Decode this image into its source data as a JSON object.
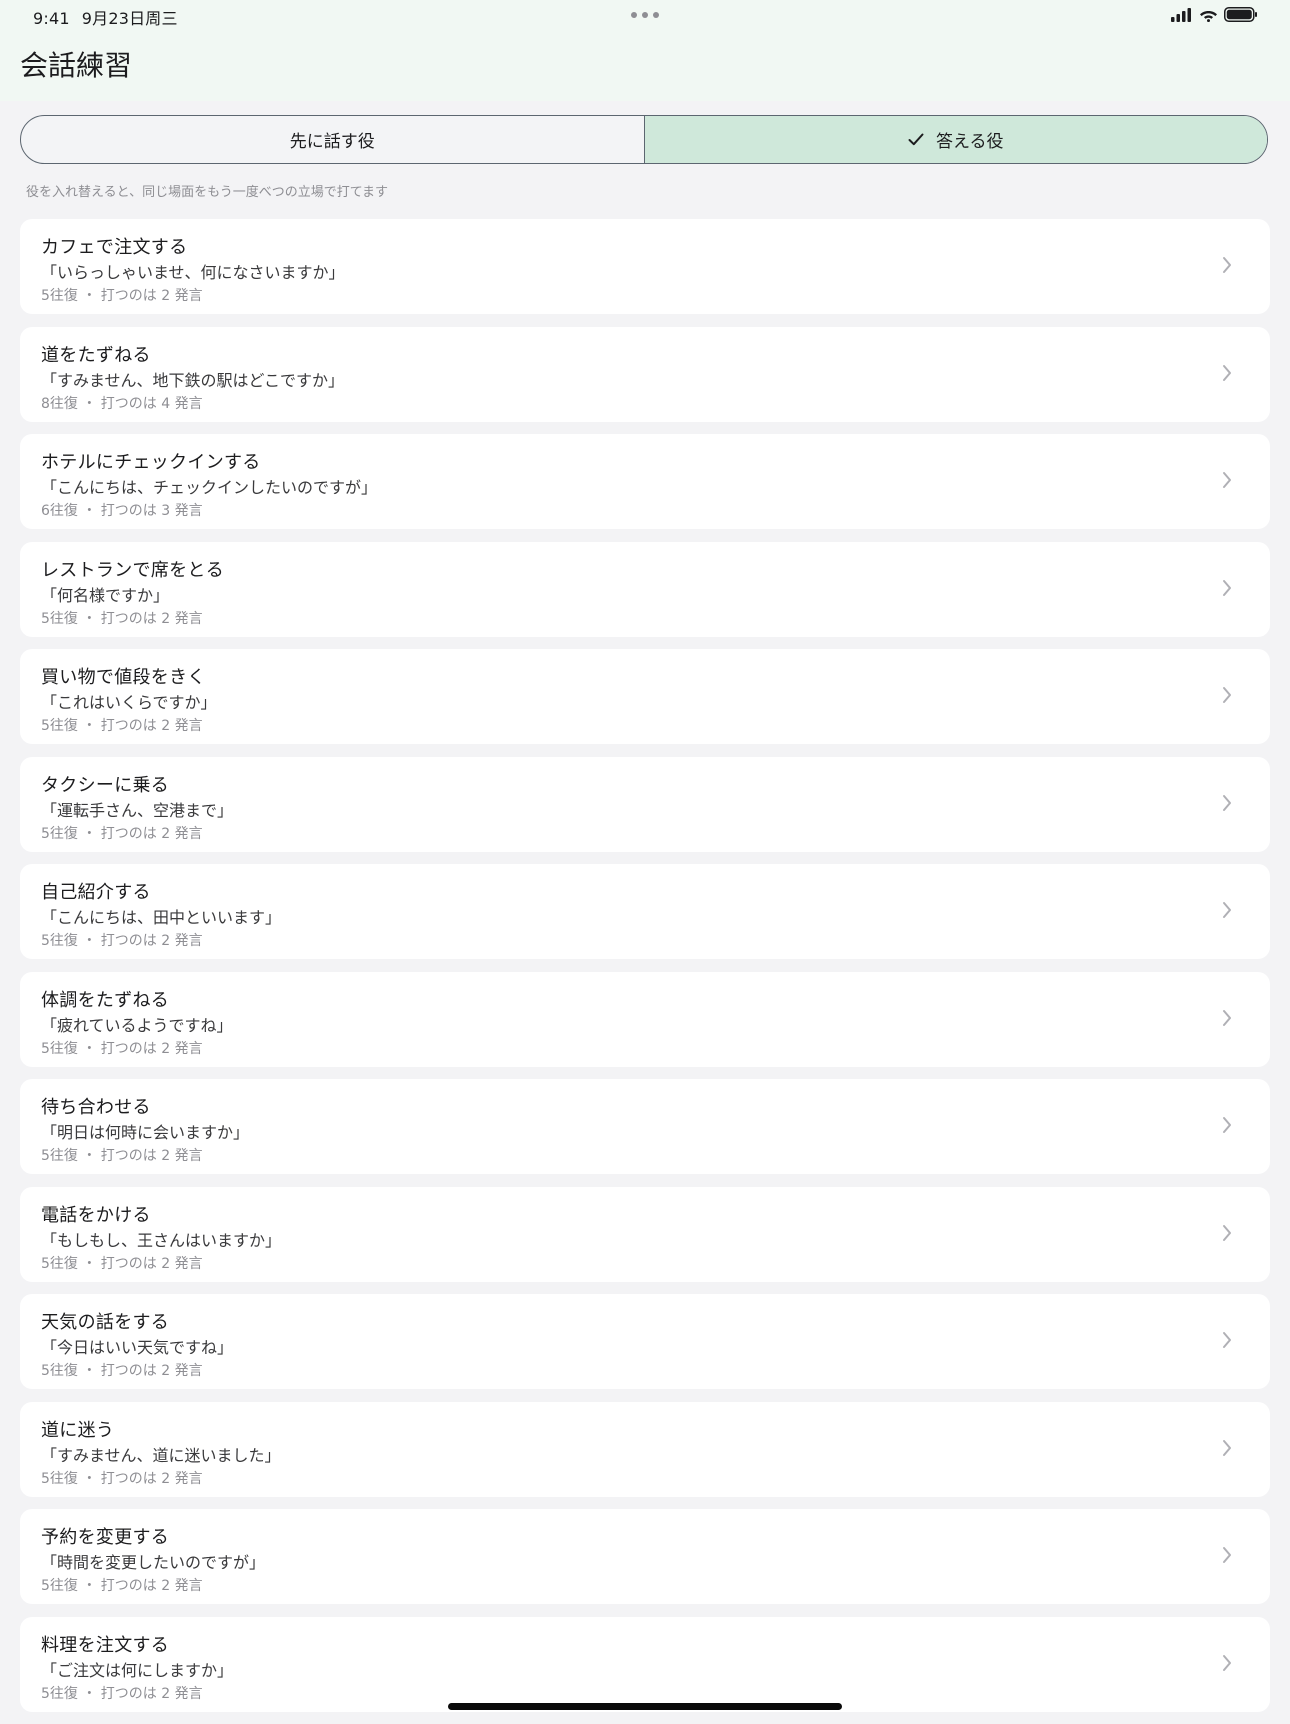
{
  "status": {
    "time": "9:41",
    "date": "9月23日周三"
  },
  "header": {
    "title": "会話練習"
  },
  "role_toggle": {
    "options": [
      "先に話す役",
      "答える役"
    ],
    "selected": "答える役"
  },
  "hint": "役を入れ替えると、同じ場面をもう一度べつの立場で打てます",
  "colors": {
    "header_bg": "#f1f8f3",
    "selected_segment": "#cfe8da",
    "page_bg": "#f3f3f5"
  },
  "scenarios": [
    {
      "title": "カフェで注文する",
      "quote": "「いらっしゃいませ、何になさいますか」",
      "meta": "5往復 ・ 打つのは 2 発言"
    },
    {
      "title": "道をたずねる",
      "quote": "「すみません、地下鉄の駅はどこですか」",
      "meta": "8往復 ・ 打つのは 4 発言"
    },
    {
      "title": "ホテルにチェックインする",
      "quote": "「こんにちは、チェックインしたいのですが」",
      "meta": "6往復 ・ 打つのは 3 発言"
    },
    {
      "title": "レストランで席をとる",
      "quote": "「何名様ですか」",
      "meta": "5往復 ・ 打つのは 2 発言"
    },
    {
      "title": "買い物で値段をきく",
      "quote": "「これはいくらですか」",
      "meta": "5往復 ・ 打つのは 2 発言"
    },
    {
      "title": "タクシーに乗る",
      "quote": "「運転手さん、空港まで」",
      "meta": "5往復 ・ 打つのは 2 発言"
    },
    {
      "title": "自己紹介する",
      "quote": "「こんにちは、田中といいます」",
      "meta": "5往復 ・ 打つのは 2 発言"
    },
    {
      "title": "体調をたずねる",
      "quote": "「疲れているようですね」",
      "meta": "5往復 ・ 打つのは 2 発言"
    },
    {
      "title": "待ち合わせる",
      "quote": "「明日は何時に会いますか」",
      "meta": "5往復 ・ 打つのは 2 発言"
    },
    {
      "title": "電話をかける",
      "quote": "「もしもし、王さんはいますか」",
      "meta": "5往復 ・ 打つのは 2 発言"
    },
    {
      "title": "天気の話をする",
      "quote": "「今日はいい天気ですね」",
      "meta": "5往復 ・ 打つのは 2 発言"
    },
    {
      "title": "道に迷う",
      "quote": "「すみません、道に迷いました」",
      "meta": "5往復 ・ 打つのは 2 発言"
    },
    {
      "title": "予約を変更する",
      "quote": "「時間を変更したいのですが」",
      "meta": "5往復 ・ 打つのは 2 発言"
    },
    {
      "title": "料理を注文する",
      "quote": "「ご注文は何にしますか」",
      "meta": "5往復 ・ 打つのは 2 発言"
    }
  ]
}
